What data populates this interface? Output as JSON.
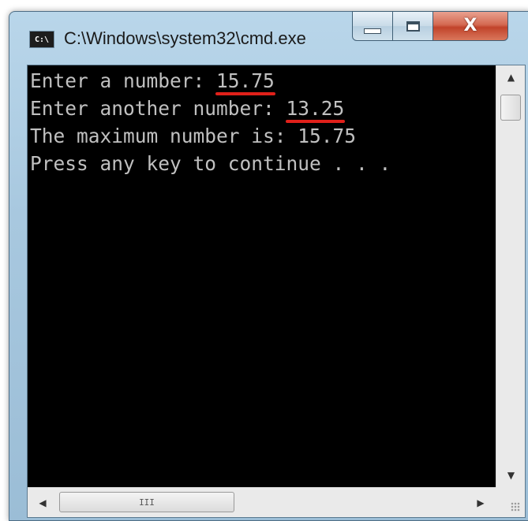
{
  "window": {
    "title": "C:\\Windows\\system32\\cmd.exe",
    "icon_text": "C:\\",
    "controls": {
      "minimize_icon": "minimize-icon",
      "maximize_icon": "maximize-icon",
      "close_icon": "close-icon",
      "close_glyph": "X"
    }
  },
  "console": {
    "lines": [
      {
        "prefix": "Enter a number: ",
        "value": "15.75",
        "value_underlined": true
      },
      {
        "prefix": "Enter another number: ",
        "value": "13.25",
        "value_underlined": true
      },
      {
        "prefix": "The maximum number is: 15.75",
        "value": "",
        "value_underlined": false
      },
      {
        "prefix": "Press any key to continue . . .",
        "value": "",
        "value_underlined": false
      }
    ],
    "text_color": "#c0c0c0",
    "background_color": "#000000",
    "underline_color": "#e0201a"
  },
  "scrollbars": {
    "horizontal_thumb_grip": "III",
    "up_arrow": "▲",
    "down_arrow": "▼",
    "left_arrow": "◀",
    "right_arrow": "▶"
  }
}
